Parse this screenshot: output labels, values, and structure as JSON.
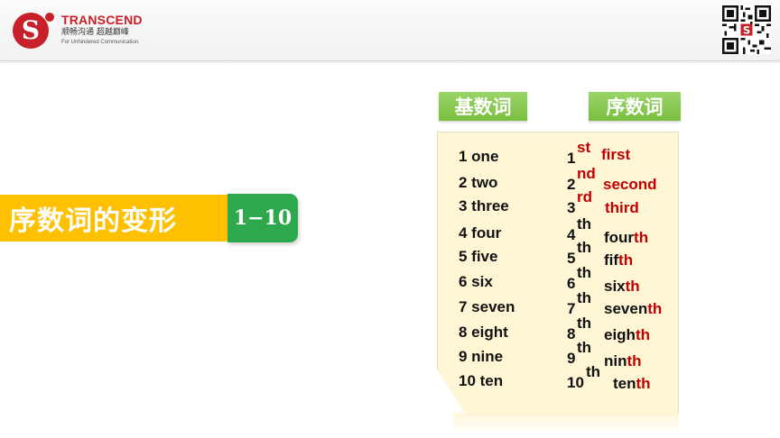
{
  "brand": {
    "name": "TRANSCEND",
    "chinese_slogan": "顺畅沟通  超越巅峰",
    "english_slogan": "For Unhindered Communication.",
    "logo_letter": "S",
    "accent_color": "#c8202a"
  },
  "title": {
    "text": "序数词的变形",
    "range": "1−10",
    "bar_color": "#ffc000",
    "range_color": "#2ea84c"
  },
  "tabs": {
    "cardinal": "基数词",
    "ordinal": "序数词",
    "color": "#78bf3e"
  },
  "cardinals": [
    "1 one",
    "2 two",
    "3 three",
    "4 four",
    "5 five",
    "6 six",
    "7 seven",
    "8 eight",
    "9 nine",
    "10 ten"
  ],
  "ordinals": [
    {
      "num": "1",
      "suffix": "st",
      "stem": "first",
      "ending": ""
    },
    {
      "num": "2",
      "suffix": "nd",
      "stem": "second",
      "ending": ""
    },
    {
      "num": "3",
      "suffix": "rd",
      "stem": "third",
      "ending": ""
    },
    {
      "num": "4",
      "suffix": "th",
      "stem": "four",
      "ending": "th"
    },
    {
      "num": "5",
      "suffix": "th",
      "stem": "fif",
      "ending": "th"
    },
    {
      "num": "6",
      "suffix": "th",
      "stem": "six",
      "ending": "th"
    },
    {
      "num": "7",
      "suffix": "th",
      "stem": "seven",
      "ending": "th"
    },
    {
      "num": "8",
      "suffix": "th",
      "stem": "eigh",
      "ending": "th"
    },
    {
      "num": "9",
      "suffix": "th",
      "stem": "nin",
      "ending": "th"
    },
    {
      "num": "10",
      "suffix": "th",
      "stem": "ten",
      "ending": "th"
    }
  ]
}
